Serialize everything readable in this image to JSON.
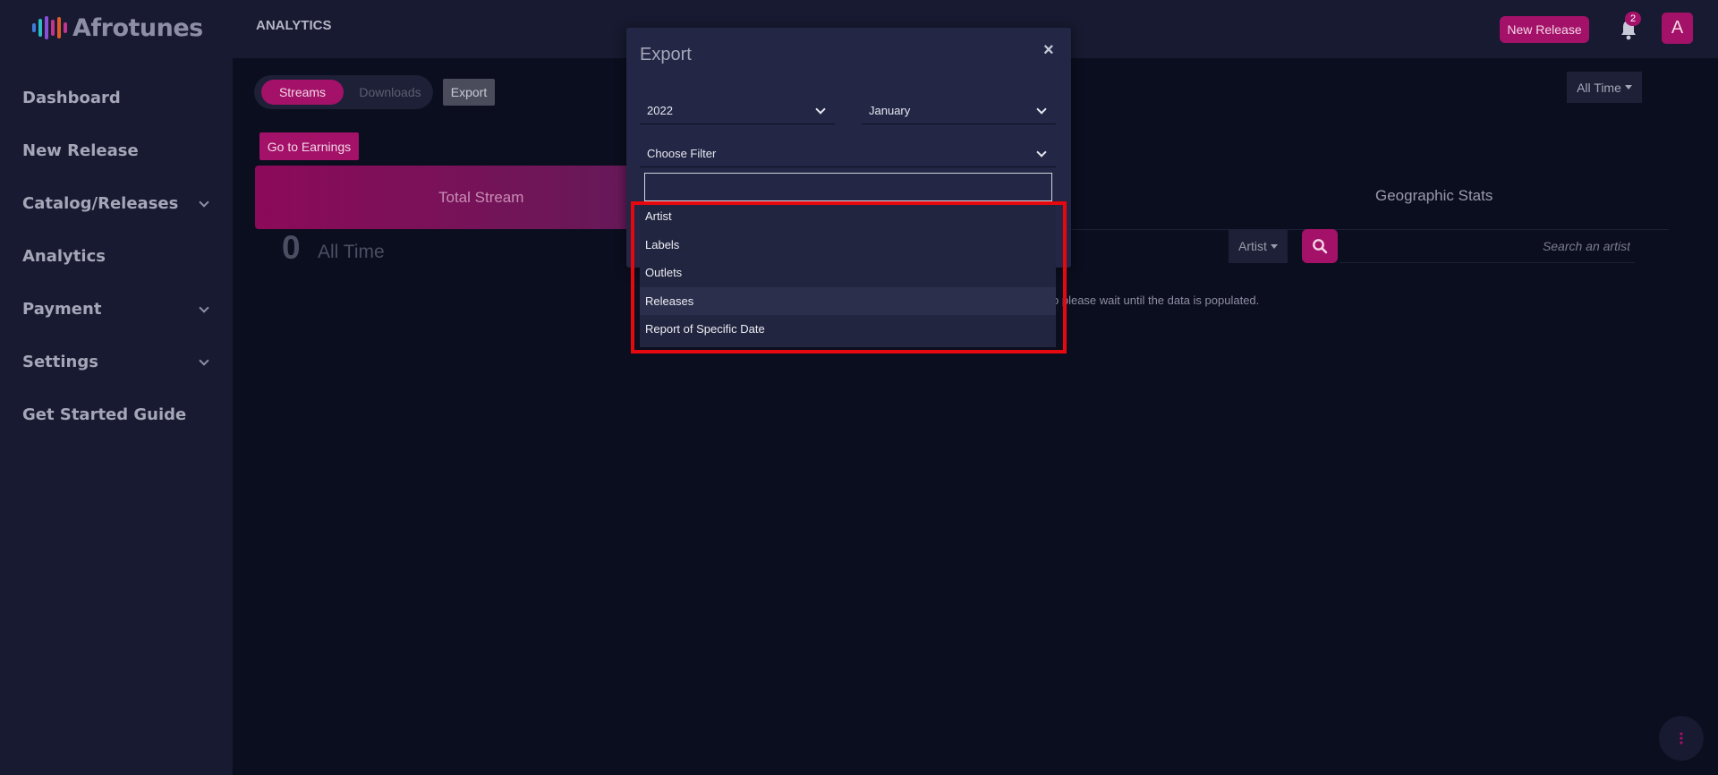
{
  "app": {
    "logo_text": "Afrotunes",
    "logo_colors": [
      "#3d7cd9",
      "#2dbbc6",
      "#8a4fd8",
      "#c2358c",
      "#e05a2c"
    ]
  },
  "sidebar": {
    "items": [
      {
        "label": "Dashboard",
        "has_submenu": false
      },
      {
        "label": "New Release",
        "has_submenu": false
      },
      {
        "label": "Catalog/Releases",
        "has_submenu": true
      },
      {
        "label": "Analytics",
        "has_submenu": false
      },
      {
        "label": "Payment",
        "has_submenu": true
      },
      {
        "label": "Settings",
        "has_submenu": true
      },
      {
        "label": "Get Started Guide",
        "has_submenu": false
      }
    ]
  },
  "topbar": {
    "page_title": "ANALYTICS",
    "new_release_label": "New Release",
    "notification_count": "2",
    "avatar_initial": "A"
  },
  "main": {
    "toggle": {
      "streams": "Streams",
      "downloads": "Downloads",
      "active": "Streams"
    },
    "export_label": "Export",
    "earnings_label": "Go to Earnings",
    "period_label": "All Time",
    "tabs": {
      "total_stream": "Total Stream",
      "geographic": "Geographic Stats"
    },
    "stat": {
      "value": "0",
      "label": "All Time"
    },
    "filter": {
      "artist_label": "Artist",
      "search_placeholder": "Search an artist"
    },
    "wait_message": "o please wait until the data is populated."
  },
  "modal": {
    "title": "Export",
    "close": "×",
    "year": "2022",
    "month": "January",
    "filter_label": "Choose Filter",
    "filter_input_value": "",
    "options": [
      "Artist",
      "Labels",
      "Outlets",
      "Releases",
      "Report of Specific Date"
    ],
    "hovered_option": "Releases"
  },
  "colors": {
    "accent": "#a31168",
    "sidebar_bg": "#171a30",
    "page_bg": "#0b0e1e",
    "modal_bg": "#232645",
    "highlight": "#e6080f"
  },
  "icons": {
    "bell": "bell-icon",
    "search": "search-icon",
    "close": "close-icon",
    "chevron": "chevron-down-icon",
    "fab": "more-vertical-icon"
  }
}
